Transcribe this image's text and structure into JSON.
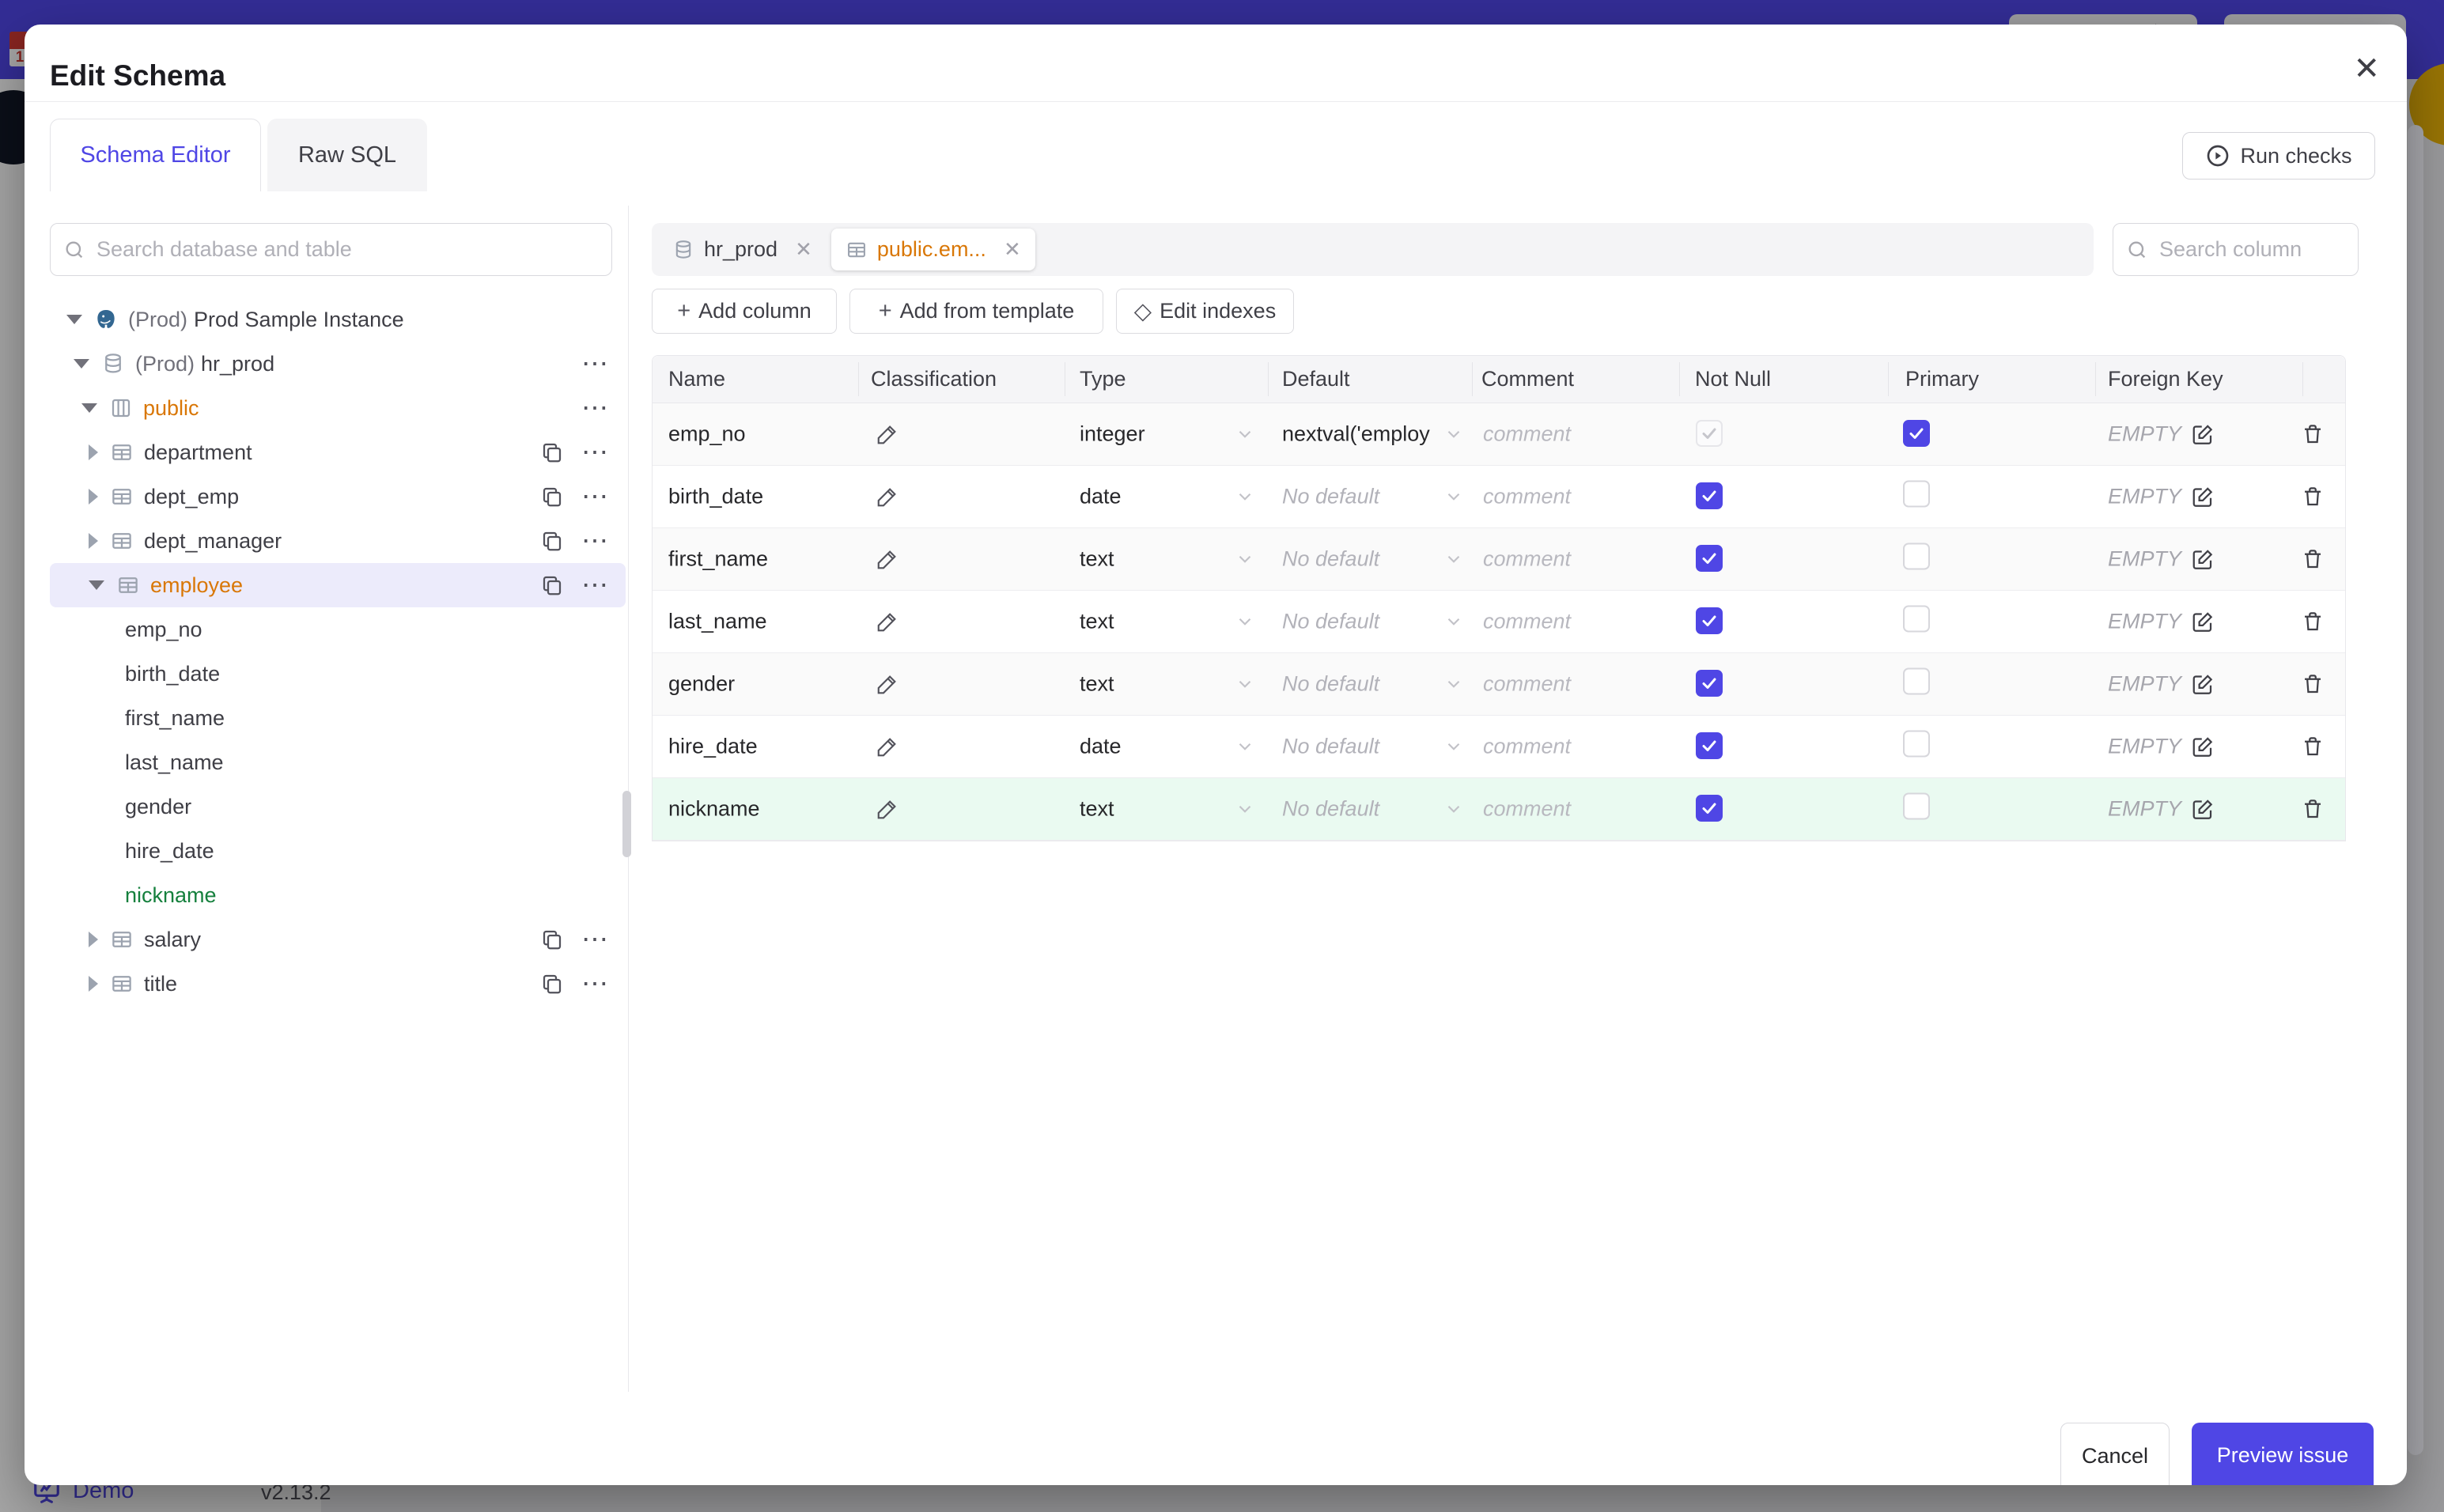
{
  "colors": {
    "accent_indigo": "#4f46e5",
    "topbar_indigo": "#4f46e5",
    "amber_selected": "#d97706",
    "green_new": "#15803d",
    "green_row_bg": "#eafaf1",
    "selected_row_bg": "#ecebfb"
  },
  "icons": {
    "close": "✕",
    "chip_close": "✕",
    "dots": "⋯",
    "plus": "+",
    "diamond": "◇"
  },
  "page_behind": {
    "demo_label": "Demo",
    "version": "v2.13.2",
    "favicon_digit": "1"
  },
  "modal": {
    "title": "Edit Schema",
    "tabs": [
      {
        "label": "Schema Editor",
        "active": true
      },
      {
        "label": "Raw SQL",
        "active": false
      }
    ],
    "run_checks_label": "Run checks",
    "sidebar": {
      "search_placeholder": "Search database and table",
      "tree": [
        {
          "prefix": "(Prod)",
          "label": "Prod Sample Instance",
          "type": "instance",
          "expanded": true
        },
        {
          "prefix": "(Prod)",
          "label": "hr_prod",
          "type": "database",
          "expanded": true,
          "more": true
        },
        {
          "label": "public",
          "type": "schema",
          "expanded": true,
          "more": true,
          "color_class": "amber"
        },
        {
          "label": "department",
          "type": "table"
        },
        {
          "label": "dept_emp",
          "type": "table"
        },
        {
          "label": "dept_manager",
          "type": "table"
        },
        {
          "label": "employee",
          "type": "table",
          "expanded": true,
          "selected": true,
          "color_class": "amber",
          "row_class": "sel"
        },
        {
          "label": "emp_no",
          "type": "column"
        },
        {
          "label": "birth_date",
          "type": "column"
        },
        {
          "label": "first_name",
          "type": "column"
        },
        {
          "label": "last_name",
          "type": "column"
        },
        {
          "label": "gender",
          "type": "column"
        },
        {
          "label": "hire_date",
          "type": "column"
        },
        {
          "label": "nickname",
          "type": "column",
          "color_class": "green"
        },
        {
          "label": "salary",
          "type": "table"
        },
        {
          "label": "title",
          "type": "table"
        }
      ]
    },
    "editor": {
      "chips": [
        {
          "label": "hr_prod",
          "icon": "database",
          "active": false
        },
        {
          "label": "public.em...",
          "icon": "table",
          "active": true
        }
      ],
      "search_placeholder": "Search column",
      "toolbar": [
        {
          "label": "Add column"
        },
        {
          "label": "Add from template"
        },
        {
          "label": "Edit indexes"
        }
      ],
      "table": {
        "headers": [
          "Name",
          "Classification",
          "Type",
          "Default",
          "Comment",
          "Not Null",
          "Primary",
          "Foreign Key"
        ],
        "comment_placeholder": "comment",
        "fk_empty_label": "EMPTY",
        "no_default_label": "No default",
        "rows": [
          {
            "name": "emp_no",
            "type": "integer",
            "default": "nextval('employ",
            "default_is_placeholder": false,
            "not_null_class": "cb-on cb-dis",
            "primary_class": "cb-on",
            "row_class": ""
          },
          {
            "name": "birth_date",
            "type": "date",
            "default": "No default",
            "default_is_placeholder": true,
            "not_null_class": "cb-on",
            "primary_class": "",
            "row_class": ""
          },
          {
            "name": "first_name",
            "type": "text",
            "default": "No default",
            "default_is_placeholder": true,
            "not_null_class": "cb-on",
            "primary_class": "",
            "row_class": ""
          },
          {
            "name": "last_name",
            "type": "text",
            "default": "No default",
            "default_is_placeholder": true,
            "not_null_class": "cb-on",
            "primary_class": "",
            "row_class": ""
          },
          {
            "name": "gender",
            "type": "text",
            "default": "No default",
            "default_is_placeholder": true,
            "not_null_class": "cb-on",
            "primary_class": "",
            "row_class": ""
          },
          {
            "name": "hire_date",
            "type": "date",
            "default": "No default",
            "default_is_placeholder": true,
            "not_null_class": "cb-on",
            "primary_class": "",
            "row_class": ""
          },
          {
            "name": "nickname",
            "type": "text",
            "default": "No default",
            "default_is_placeholder": true,
            "not_null_class": "cb-on",
            "primary_class": "",
            "row_class": "hl"
          }
        ]
      }
    },
    "footer": {
      "cancel_label": "Cancel",
      "submit_label": "Preview issue"
    }
  }
}
